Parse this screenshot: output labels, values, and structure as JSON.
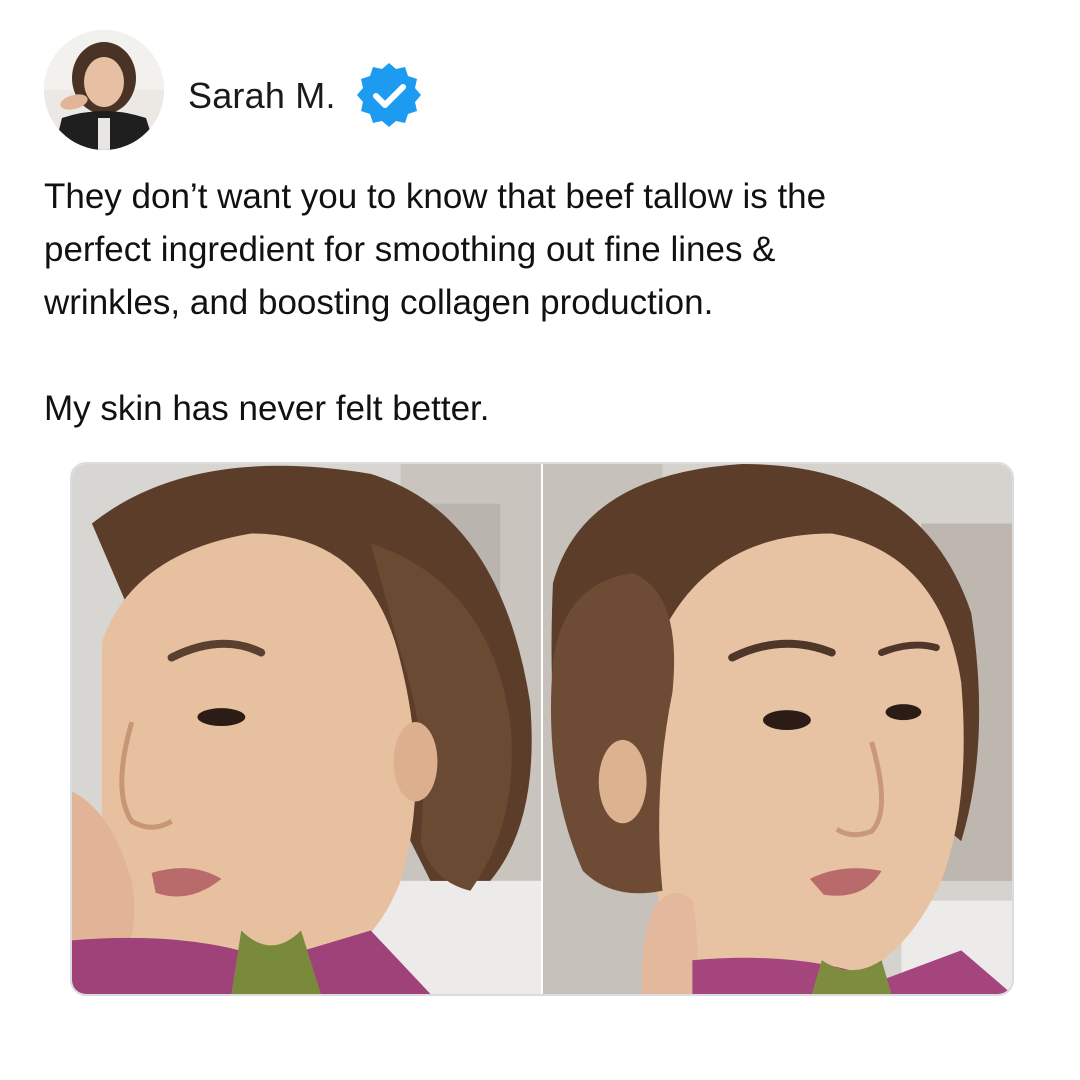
{
  "post": {
    "author_name": "Sarah M.",
    "verified": true,
    "text_line_1": "They don’t want you to know that beef tallow is the",
    "text_line_2": "perfect ingredient for smoothing out fine lines &",
    "text_line_3": "wrinkles, and boosting collagen production.",
    "text_line_4": "My skin has never felt better."
  },
  "icons": {
    "verified": "verified-badge-icon"
  },
  "colors": {
    "verified_badge": "#1d9bf0",
    "text": "#111111",
    "media_border": "#d9dde1"
  }
}
